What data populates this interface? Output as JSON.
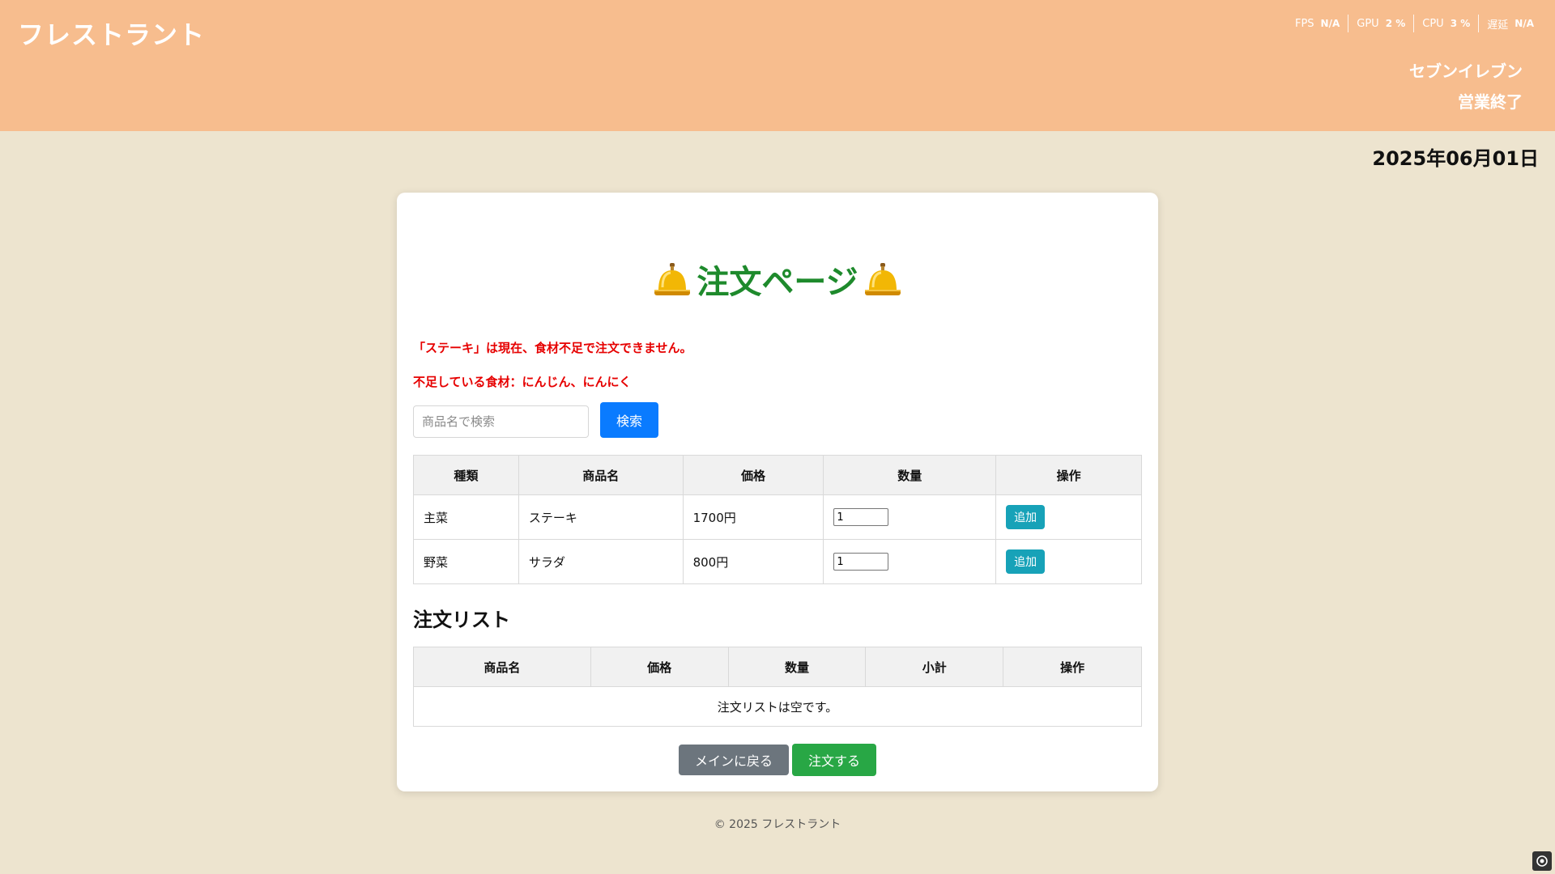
{
  "header": {
    "brand": "フレストラント",
    "perf": [
      {
        "label": "FPS",
        "value": "N/A"
      },
      {
        "label": "GPU",
        "value": "2 %"
      },
      {
        "label": "CPU",
        "value": "3 %"
      },
      {
        "label": "遅延",
        "value": "N/A"
      }
    ],
    "store_name": "セブンイレブン",
    "store_status": "営業終了"
  },
  "date": "2025年06月01日",
  "page": {
    "title": "注文ページ",
    "alert_unavailable": "「ステーキ」は現在、食材不足で注文できません。",
    "alert_missing": "不足している食材：にんじん、にんにく",
    "search": {
      "placeholder": "商品名で検索",
      "button": "検索"
    }
  },
  "menu_table": {
    "headers": [
      "種類",
      "商品名",
      "価格",
      "数量",
      "操作"
    ],
    "rows": [
      {
        "category": "主菜",
        "name": "ステーキ",
        "price": "1700円",
        "qty": "1",
        "action": "追加"
      },
      {
        "category": "野菜",
        "name": "サラダ",
        "price": "800円",
        "qty": "1",
        "action": "追加"
      }
    ]
  },
  "order_list": {
    "heading": "注文リスト",
    "headers": [
      "商品名",
      "価格",
      "数量",
      "小計",
      "操作"
    ],
    "empty_message": "注文リストは空です。"
  },
  "buttons": {
    "back": "メインに戻る",
    "order": "注文する"
  },
  "footer": "© 2025 フレストラント",
  "colors": {
    "header_bg": "#f7bd8e",
    "page_bg": "#ede4cf",
    "title_green": "#1e8a2c",
    "alert_red": "#e60000",
    "primary_blue": "#0a7bff",
    "add_teal": "#17a2b8",
    "back_gray": "#6c757d",
    "order_green": "#28a745"
  }
}
